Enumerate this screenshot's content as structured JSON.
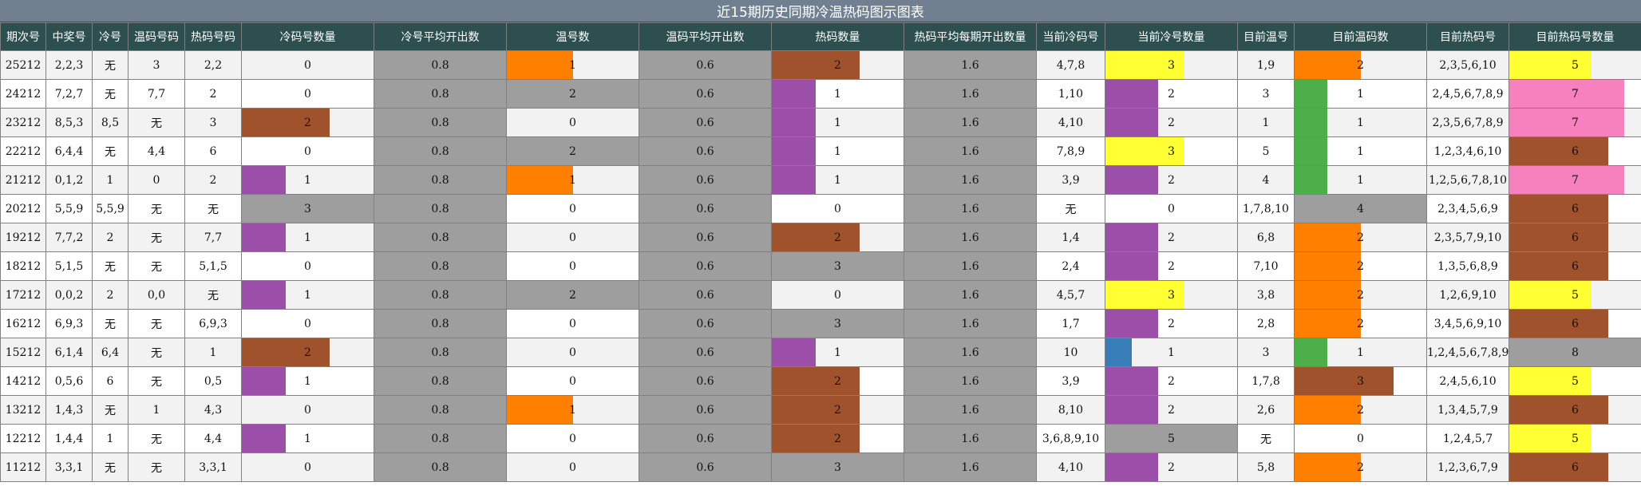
{
  "title": "近15期历史同期冷温热码图示图表",
  "headers": [
    "期次号",
    "中奖号",
    "冷号",
    "温码号码",
    "热码号码",
    "冷码号数量",
    "冷号平均开出数",
    "温号数",
    "温码平均开出数",
    "热码数量",
    "热码平均每期开出数量",
    "当前冷码号",
    "当前冷号数量",
    "目前温号",
    "目前温码数",
    "目前热码号",
    "目前热码号数量"
  ],
  "colors": {
    "c1": "#9b4fa8",
    "c2": "#a0522d",
    "c3": "#9e9e9e",
    "c4": "#ff7f00",
    "c5": "#ffff33",
    "c7": "#f781bf",
    "c8": "#9e9e9e",
    "cur_cold_1": "#377eb8",
    "cur_cold_2": "#9b4fa8",
    "cur_cold_3": "#ffff33",
    "cur_cold_5": "#9e9e9e",
    "warm_1": "#4daf4a",
    "warm_2": "#ff7f00",
    "warm_3": "#a0522d",
    "warm_4": "#9e9e9e"
  },
  "rows": [
    [
      "25212",
      "2,2,3",
      "无",
      "3",
      "2,2",
      "0",
      "0.8",
      "1",
      "0.6",
      "2",
      "1.6",
      "4,7,8",
      "3",
      "1,9",
      "2",
      "2,3,5,6,10",
      "5"
    ],
    [
      "24212",
      "7,2,7",
      "无",
      "7,7",
      "2",
      "0",
      "0.8",
      "2",
      "0.6",
      "1",
      "1.6",
      "1,10",
      "2",
      "3",
      "1",
      "2,4,5,6,7,8,9",
      "7"
    ],
    [
      "23212",
      "8,5,3",
      "8,5",
      "无",
      "3",
      "2",
      "0.8",
      "0",
      "0.6",
      "1",
      "1.6",
      "4,10",
      "2",
      "1",
      "1",
      "2,3,5,6,7,8,9",
      "7"
    ],
    [
      "22212",
      "6,4,4",
      "无",
      "4,4",
      "6",
      "0",
      "0.8",
      "2",
      "0.6",
      "1",
      "1.6",
      "7,8,9",
      "3",
      "5",
      "1",
      "1,2,3,4,6,10",
      "6"
    ],
    [
      "21212",
      "0,1,2",
      "1",
      "0",
      "2",
      "1",
      "0.8",
      "1",
      "0.6",
      "1",
      "1.6",
      "3,9",
      "2",
      "4",
      "1",
      "1,2,5,6,7,8,10",
      "7"
    ],
    [
      "20212",
      "5,5,9",
      "5,5,9",
      "无",
      "无",
      "3",
      "0.8",
      "0",
      "0.6",
      "0",
      "1.6",
      "无",
      "0",
      "1,7,8,10",
      "4",
      "2,3,4,5,6,9",
      "6"
    ],
    [
      "19212",
      "7,7,2",
      "2",
      "无",
      "7,7",
      "1",
      "0.8",
      "0",
      "0.6",
      "2",
      "1.6",
      "1,4",
      "2",
      "6,8",
      "2",
      "2,3,5,7,9,10",
      "6"
    ],
    [
      "18212",
      "5,1,5",
      "无",
      "无",
      "5,1,5",
      "0",
      "0.8",
      "0",
      "0.6",
      "3",
      "1.6",
      "2,4",
      "2",
      "7,10",
      "2",
      "1,3,5,6,8,9",
      "6"
    ],
    [
      "17212",
      "0,0,2",
      "2",
      "0,0",
      "无",
      "1",
      "0.8",
      "2",
      "0.6",
      "0",
      "1.6",
      "4,5,7",
      "3",
      "3,8",
      "2",
      "1,2,6,9,10",
      "5"
    ],
    [
      "16212",
      "6,9,3",
      "无",
      "无",
      "6,9,3",
      "0",
      "0.8",
      "0",
      "0.6",
      "3",
      "1.6",
      "1,7",
      "2",
      "2,8",
      "2",
      "3,4,5,6,9,10",
      "6"
    ],
    [
      "15212",
      "6,1,4",
      "6,4",
      "无",
      "1",
      "2",
      "0.8",
      "0",
      "0.6",
      "1",
      "1.6",
      "10",
      "1",
      "3",
      "1",
      "1,2,4,5,6,7,8,9",
      "8"
    ],
    [
      "14212",
      "0,5,6",
      "6",
      "无",
      "0,5",
      "1",
      "0.8",
      "0",
      "0.6",
      "2",
      "1.6",
      "3,9",
      "2",
      "1,7,8",
      "3",
      "2,4,5,6,10",
      "5"
    ],
    [
      "13212",
      "1,4,3",
      "无",
      "1",
      "4,3",
      "0",
      "0.8",
      "1",
      "0.6",
      "2",
      "1.6",
      "8,10",
      "2",
      "2,6",
      "2",
      "1,3,4,5,7,9",
      "6"
    ],
    [
      "12212",
      "1,4,4",
      "1",
      "无",
      "4,4",
      "1",
      "0.8",
      "0",
      "0.6",
      "2",
      "1.6",
      "3,6,8,9,10",
      "5",
      "无",
      "0",
      "1,2,4,5,7",
      "5"
    ],
    [
      "11212",
      "3,3,1",
      "无",
      "无",
      "3,3,1",
      "0",
      "0.8",
      "0",
      "0.6",
      "3",
      "1.6",
      "4,10",
      "2",
      "5,8",
      "2",
      "1,2,3,6,7,9",
      "6"
    ]
  ]
}
